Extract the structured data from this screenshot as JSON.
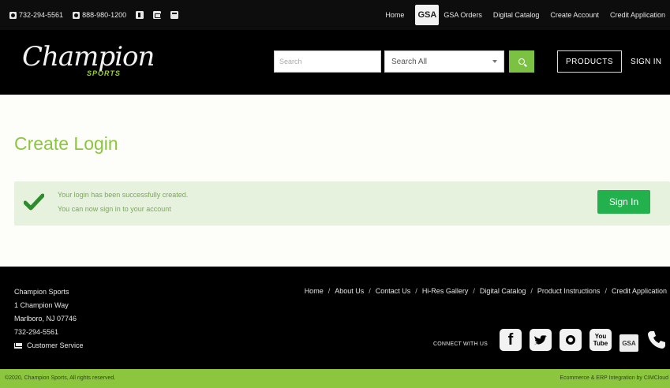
{
  "topbar": {
    "phone1": "732-294-5561",
    "phone2": "888-980-1200",
    "nav": [
      "Home",
      "GSA Orders",
      "Digital Catalog",
      "Create Account",
      "Credit Application"
    ],
    "gsa_badge": "GSA"
  },
  "header": {
    "logo_script": "Champion",
    "logo_sports": "SPORTS",
    "search_placeholder": "Search",
    "search_scope": "Search All",
    "products_label": "PRODUCTS",
    "signin_label": "SIGN IN"
  },
  "main": {
    "title": "Create Login",
    "alert_line1": "Your login has been successfully created.",
    "alert_line2": "You can now sign in to your account",
    "alert_button": "Sign In"
  },
  "footer": {
    "company": "Champion Sports",
    "street": "1 Champion Way",
    "city": "Marlboro, NJ 07746",
    "phone": "732-294-5561",
    "customer_service": "Customer Service",
    "links": [
      "Home",
      "About Us",
      "Contact Us",
      "Hi-Res Gallery",
      "Digital Catalog",
      "Product Instructions",
      "Credit Application"
    ],
    "connect_label": "CONNECT WITH US",
    "social_icons": [
      "facebook-icon",
      "twitter-icon",
      "instagram-icon",
      "youtube-icon",
      "gsa-icon",
      "phone-icon"
    ],
    "youtube_top": "You",
    "youtube_bottom": "Tube",
    "gsa": "GSA"
  },
  "bottombar": {
    "copyright": "©2020, Champion Sports, All rights reserved.",
    "credit": "Ecommerce & ERP Integration by CIMCloud"
  },
  "colors": {
    "accent_green": "#8cc63f",
    "button_green": "#22b14c",
    "search_green": "#7cc242",
    "alert_bg": "#e6f2dd"
  }
}
